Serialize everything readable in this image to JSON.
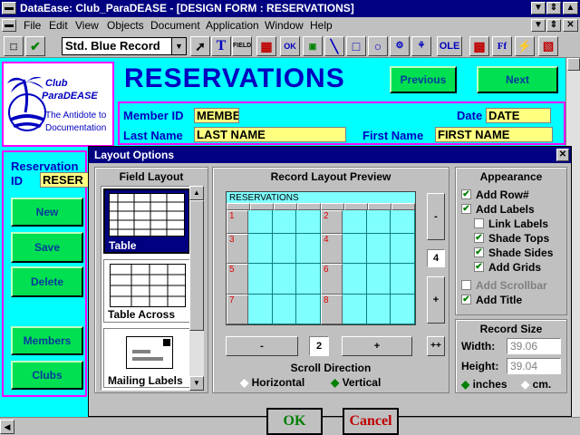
{
  "window": {
    "title": "DataEase: Club_ParaDEASE - [DESIGN FORM : RESERVATIONS]"
  },
  "menu": [
    "File",
    "Edit",
    "View",
    "Objects",
    "Document",
    "Application",
    "Window",
    "Help"
  ],
  "toolbar": {
    "style_value": "Std. Blue Record",
    "field_label": "FIELD",
    "ok_label": "OK",
    "ole_label": "OLE",
    "ff_label": "Ff"
  },
  "form": {
    "title": "RESERVATIONS",
    "logo": {
      "line1": "Club",
      "line2": "ParaDEASE",
      "line3": "The Antidote to",
      "line4": "Documentation"
    },
    "previous_label": "Previous",
    "next_label": "Next",
    "member_id_label": "Member ID",
    "member_id_value": "MEMBE",
    "date_label": "Date",
    "date_value": "DATE",
    "last_name_label": "Last Name",
    "last_name_value": "LAST NAME",
    "first_name_label": "First Name",
    "first_name_value": "FIRST NAME",
    "reservation_label1": "Reservation",
    "reservation_label2": "ID",
    "reservation_value": "RESER",
    "side_buttons": [
      "New",
      "Save",
      "Delete",
      "Members",
      "Clubs"
    ]
  },
  "dialog": {
    "title": "Layout Options",
    "field_layout_heading": "Field Layout",
    "layouts": [
      "Table",
      "Table Across",
      "Mailing Labels"
    ],
    "preview_heading": "Record Layout Preview",
    "preview_title": "RESERVATIONS",
    "row_numbers": [
      "1",
      "2",
      "3",
      "4",
      "5",
      "6",
      "7",
      "8"
    ],
    "minus_label": "-",
    "plus_label": "+",
    "plusplus_label": "++",
    "rows_value": "4",
    "across_value": "2",
    "scroll_direction_label": "Scroll Direction",
    "horizontal_label": "Horizontal",
    "vertical_label": "Vertical",
    "scroll_direction_selected": "Vertical",
    "appearance_heading": "Appearance",
    "appearance_options": [
      {
        "label": "Add Row#",
        "checked": true
      },
      {
        "label": "Add Labels",
        "checked": true
      },
      {
        "label": "Link Labels",
        "checked": false
      },
      {
        "label": "Shade Tops",
        "checked": true
      },
      {
        "label": "Shade Sides",
        "checked": true
      },
      {
        "label": "Add Grids",
        "checked": true
      },
      {
        "label": "Add Scrollbar",
        "checked": false
      },
      {
        "label": "Add Title",
        "checked": true
      }
    ],
    "record_size_heading": "Record Size",
    "width_label": "Width:",
    "width_value": "39.06",
    "height_label": "Height:",
    "height_value": "39.04",
    "inches_label": "inches",
    "cm_label": "cm.",
    "units_selected": "inches",
    "ok_label": "OK",
    "cancel_label": "Cancel"
  },
  "colors": {
    "canvas": "#00ffff",
    "title_blue": "#0000c0",
    "green_button": "#00e050",
    "field_yellow": "#ffff80",
    "frame_magenta": "#ff00ff"
  }
}
